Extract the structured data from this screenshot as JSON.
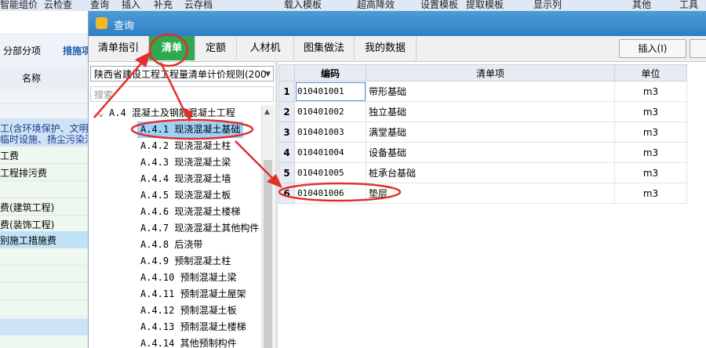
{
  "background": {
    "toolbar_items": [
      "智能组价",
      "云检查",
      "查询",
      "插入",
      "补充",
      "云存档",
      "载入模板",
      "超高降效",
      "设置模板",
      "提取模板",
      "显示列",
      "其他",
      "工具"
    ],
    "left_tabs": [
      "分部分项",
      "措施项"
    ],
    "left_header": "名称",
    "left_rows": [
      "工(含环境保护、文明施",
      "临时设施、扬尘污染治",
      "工费",
      "工程排污费",
      "",
      "费(建筑工程)",
      "费(装饰工程)",
      "别施工措施费",
      "",
      "",
      "",
      "",
      "",
      "",
      "",
      ""
    ]
  },
  "dialog": {
    "title": "查询",
    "tabs": [
      "清单指引",
      "清单",
      "定额",
      "人材机",
      "图集做法",
      "我的数据"
    ],
    "active_tab": 1,
    "insert_button": "插入(I)",
    "rule_select": "陕西省建设工程工程量清单计价规则(200",
    "search_placeholder": "搜索",
    "tree": [
      {
        "label": "A.4  混凝土及钢筋混凝土工程",
        "level": 0,
        "expanded": true
      },
      {
        "label": "A.4.1  现浇混凝土基础",
        "level": 1,
        "selected": true
      },
      {
        "label": "A.4.2  现浇混凝土柱",
        "level": 1
      },
      {
        "label": "A.4.3  现浇混凝土梁",
        "level": 1
      },
      {
        "label": "A.4.4  现浇混凝土墙",
        "level": 1
      },
      {
        "label": "A.4.5  现浇混凝土板",
        "level": 1
      },
      {
        "label": "A.4.6  现浇混凝土楼梯",
        "level": 1
      },
      {
        "label": "A.4.7  现浇混凝土其他构件",
        "level": 1
      },
      {
        "label": "A.4.8  后浇带",
        "level": 1
      },
      {
        "label": "A.4.9  预制混凝土柱",
        "level": 1
      },
      {
        "label": "A.4.10  预制混凝土梁",
        "level": 1
      },
      {
        "label": "A.4.11  预制混凝土屋架",
        "level": 1
      },
      {
        "label": "A.4.12  预制混凝土板",
        "level": 1
      },
      {
        "label": "A.4.13  预制混凝土楼梯",
        "level": 1
      },
      {
        "label": "A.4.14  其他预制构件",
        "level": 1
      }
    ],
    "grid": {
      "columns": [
        "编码",
        "清单项",
        "单位"
      ],
      "rows": [
        {
          "num": "1",
          "code": "010401001",
          "name": "带形基础",
          "unit": "m3"
        },
        {
          "num": "2",
          "code": "010401002",
          "name": "独立基础",
          "unit": "m3"
        },
        {
          "num": "3",
          "code": "010401003",
          "name": "满堂基础",
          "unit": "m3"
        },
        {
          "num": "4",
          "code": "010401004",
          "name": "设备基础",
          "unit": "m3"
        },
        {
          "num": "5",
          "code": "010401005",
          "name": "桩承台基础",
          "unit": "m3"
        },
        {
          "num": "6",
          "code": "010401006",
          "name": "垫层",
          "unit": "m3"
        }
      ]
    }
  },
  "colors": {
    "title_bar": "#2f7fc4",
    "active_tab": "#2fa84f",
    "selection": "#9fd1f7",
    "annotation": "#e0302a"
  }
}
